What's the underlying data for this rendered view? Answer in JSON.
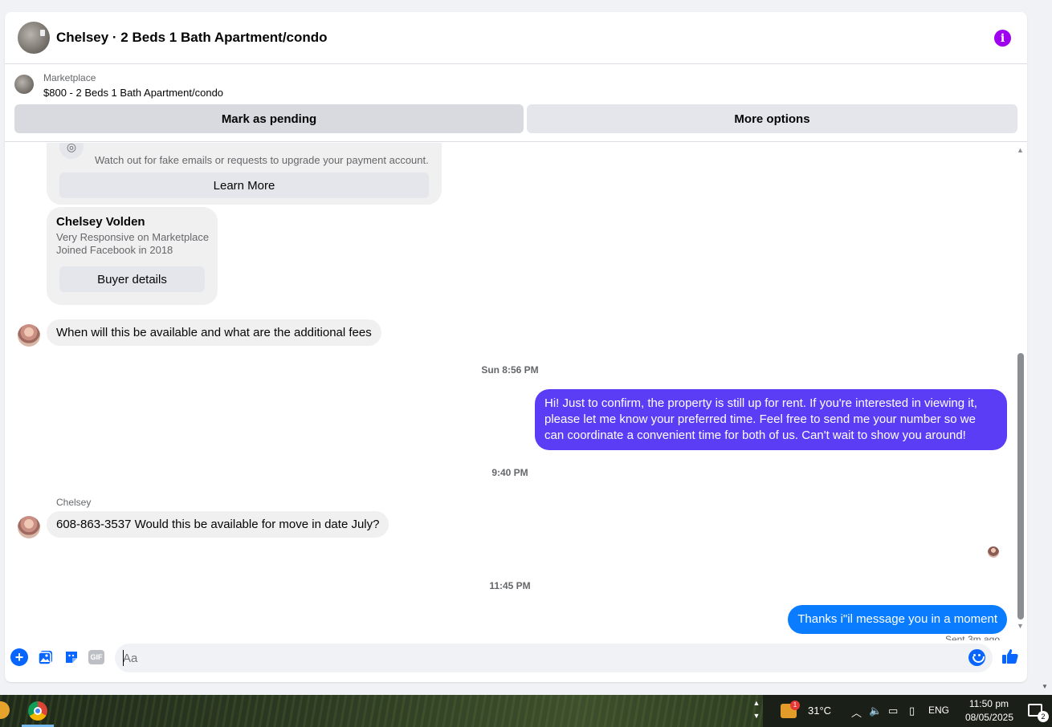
{
  "header": {
    "title": "Chelsey · 2 Beds 1 Bath Apartment/condo",
    "info_icon": "info-icon"
  },
  "listing": {
    "label": "Marketplace",
    "price_title": "$800 - 2 Beds 1 Bath Apartment/condo",
    "pending_label": "Mark as pending",
    "more_label": "More options"
  },
  "safety_card": {
    "text": "Watch out for fake emails or requests to upgrade your payment account.",
    "button_label": "Learn More"
  },
  "buyer_card": {
    "name": "Chelsey Volden",
    "line1": "Very Responsive on Marketplace",
    "line2": "Joined Facebook in 2018",
    "button_label": "Buyer details"
  },
  "messages": [
    {
      "type": "incoming",
      "text": "When will this be available and what are the additional fees"
    },
    {
      "type": "timestamp",
      "text": "Sun 8:56 PM"
    },
    {
      "type": "outgoing",
      "text": "Hi! Just to confirm, the property is still up for rent. If you're interested in viewing it, please let me know your preferred time. Feel free to send me your number so we can coordinate a convenient time for both of us. Can't wait to show you around!"
    },
    {
      "type": "timestamp",
      "text": "9:40 PM"
    },
    {
      "type": "sender",
      "text": "Chelsey"
    },
    {
      "type": "incoming",
      "text": "608-863-3537 Would this be available for move in date July?"
    },
    {
      "type": "timestamp",
      "text": "11:45 PM"
    },
    {
      "type": "outgoing",
      "text": "Thanks i\"il message you in a moment"
    },
    {
      "type": "status",
      "text": "Sent 3m ago"
    }
  ],
  "composer": {
    "placeholder": "Aa",
    "gif_label": "GIF"
  },
  "taskbar": {
    "temperature": "31°C",
    "weather_badge": "1",
    "language": "ENG",
    "time": "11:50 pm",
    "date": "08/05/2025",
    "notifications_count": "2"
  },
  "colors": {
    "accent_blue": "#0866ff",
    "bubble_purple": "#5a3df5",
    "bubble_blue": "#0a7cff",
    "info_purple": "#a000f0"
  }
}
